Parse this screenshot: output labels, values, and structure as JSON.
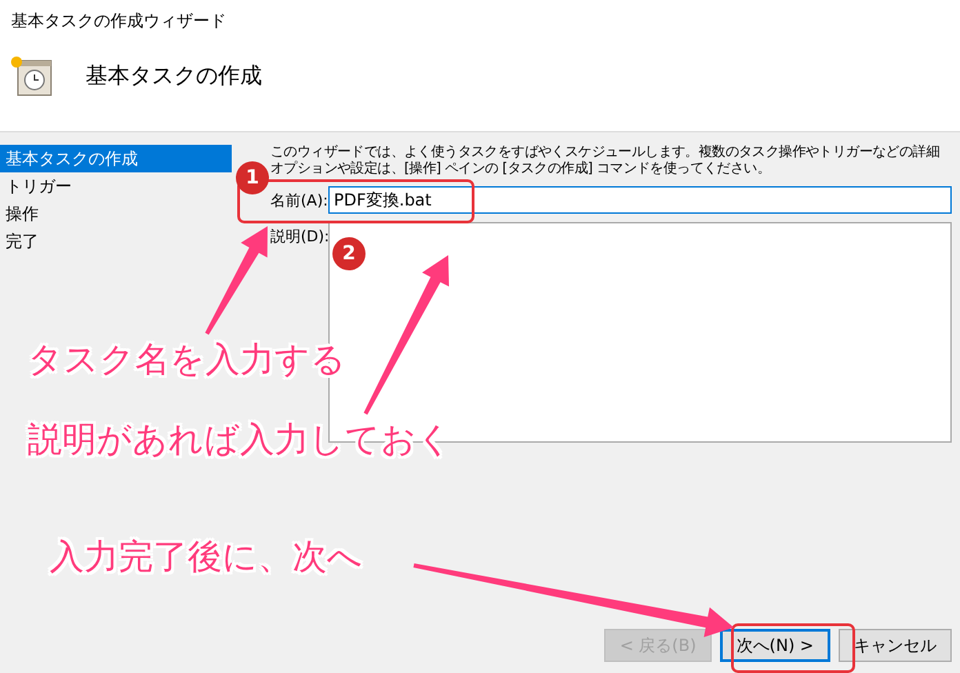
{
  "window": {
    "title": "基本タスクの作成ウィザード"
  },
  "header": {
    "title": "基本タスクの作成"
  },
  "steps": [
    {
      "label": "基本タスクの作成",
      "selected": true
    },
    {
      "label": "トリガー",
      "selected": false
    },
    {
      "label": "操作",
      "selected": false
    },
    {
      "label": "完了",
      "selected": false
    }
  ],
  "intro": "このウィザードでは、よく使うタスクをすばやくスケジュールします。複数のタスク操作やトリガーなどの詳細オプションや設定は、[操作] ペインの [タスクの作成] コマンドを使ってください。",
  "name_field": {
    "label": "名前(A):",
    "value": "PDF変換.bat"
  },
  "description_field": {
    "label": "説明(D):"
  },
  "buttons": [
    {
      "label": "< 戻る(B)",
      "disabled": true,
      "default": false
    },
    {
      "label": "次へ(N) >",
      "disabled": false,
      "default": true
    },
    {
      "label": "キャンセル",
      "disabled": false,
      "default": false
    }
  ],
  "markers": [
    "1",
    "2"
  ],
  "callouts": [
    "タスク名を入力する",
    "説明があれば入力しておく",
    "入力完了後に、次へ"
  ]
}
